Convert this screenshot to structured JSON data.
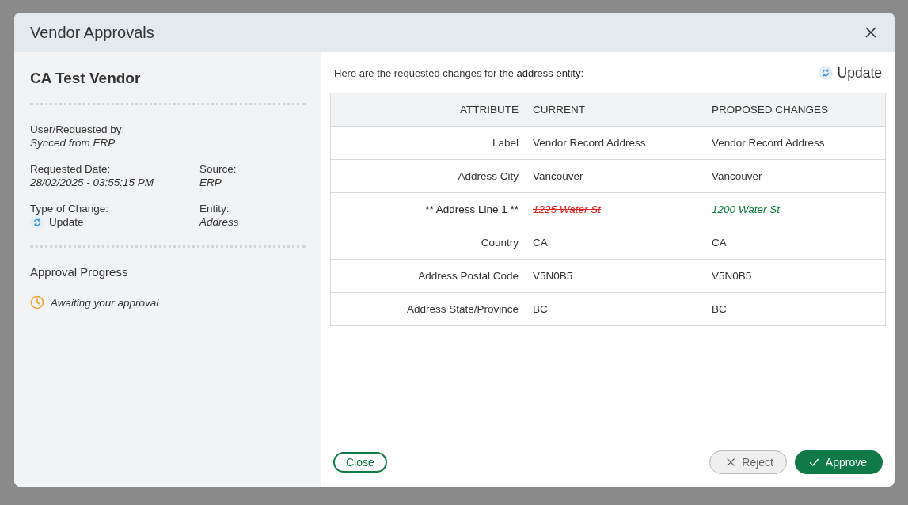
{
  "dialog": {
    "title": "Vendor Approvals"
  },
  "summary": {
    "vendor": "CA Test Vendor",
    "fields": [
      {
        "label": "User/Requested by:",
        "value": "Synced from ERP",
        "kind": "text"
      },
      {
        "label": "Requested Date:",
        "value": "28/02/2025 - 03:55:15 PM",
        "kind": "text"
      },
      {
        "label": "Source:",
        "value": "ERP",
        "kind": "text"
      },
      {
        "label": "Type of Change:",
        "value": "Update",
        "kind": "change-type"
      },
      {
        "label": "Entity:",
        "value": "Address",
        "kind": "text"
      }
    ],
    "progress_title": "Approval Progress",
    "progress_status": "Awaiting your approval"
  },
  "changes": {
    "intro": "Here are the requested changes for the **address entity**:",
    "change_type": "Update",
    "columns": [
      "ATTRIBUTE",
      "CURRENT",
      "PROPOSED CHANGES"
    ],
    "rows": [
      {
        "attribute": "Label",
        "current": "Vendor Record Address",
        "proposed": "Vendor Record Address",
        "changed": false
      },
      {
        "attribute": "Address City",
        "current": "Vancouver",
        "proposed": "Vancouver",
        "changed": false
      },
      {
        "attribute": "** Address Line 1 **",
        "current": "1225 Water St",
        "proposed": "1200 Water St",
        "changed": true
      },
      {
        "attribute": "Country",
        "current": "CA",
        "proposed": "CA",
        "changed": false
      },
      {
        "attribute": "Address Postal Code",
        "current": "V5N0B5",
        "proposed": "V5N0B5",
        "changed": false
      },
      {
        "attribute": "Address State/Province",
        "current": "BC",
        "proposed": "BC",
        "changed": false
      }
    ]
  },
  "buttons": [
    {
      "label": "Close",
      "kind": "outline"
    },
    {
      "label": "Reject",
      "kind": "reject"
    },
    {
      "label": "Approve",
      "kind": "approve"
    }
  ]
}
